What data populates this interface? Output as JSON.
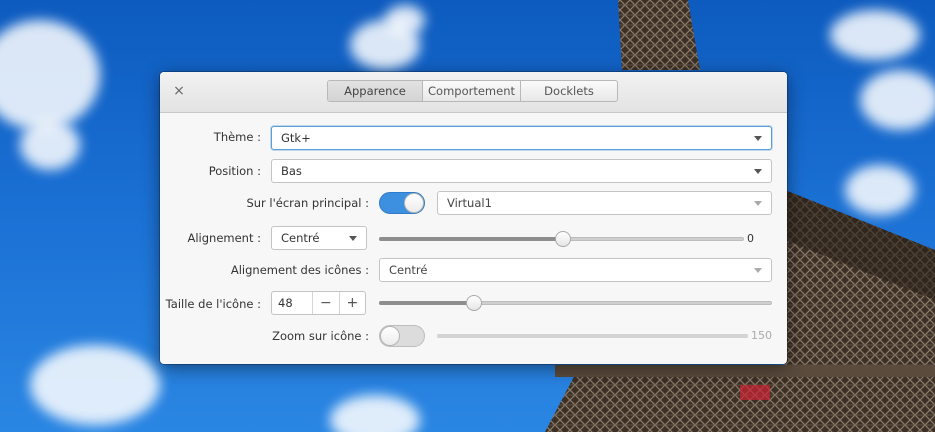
{
  "window": {
    "close_label": "×",
    "tabs": [
      {
        "label": "Apparence"
      },
      {
        "label": "Comportement"
      },
      {
        "label": "Docklets"
      }
    ]
  },
  "settings": {
    "theme": {
      "label": "Thème :",
      "value": "Gtk+"
    },
    "position": {
      "label": "Position :",
      "value": "Bas"
    },
    "primary_screen": {
      "label": "Sur l'écran principal :",
      "switch_on": true,
      "value": "Virtual1"
    },
    "alignment": {
      "label": "Alignement :",
      "value": "Centré",
      "offset_value": "0",
      "offset_level": 0.5
    },
    "icon_alignment": {
      "label": "Alignement des icônes :",
      "value": "Centré"
    },
    "icon_size": {
      "label": "Taille de l'icône :",
      "value": "48",
      "minus": "−",
      "plus": "+",
      "level": 0.24
    },
    "icon_zoom": {
      "label": "Zoom sur icône :",
      "switch_on": false,
      "value": "150"
    }
  },
  "colors": {
    "accent": "#3d8fe0",
    "sky": "#1a6fd3"
  }
}
